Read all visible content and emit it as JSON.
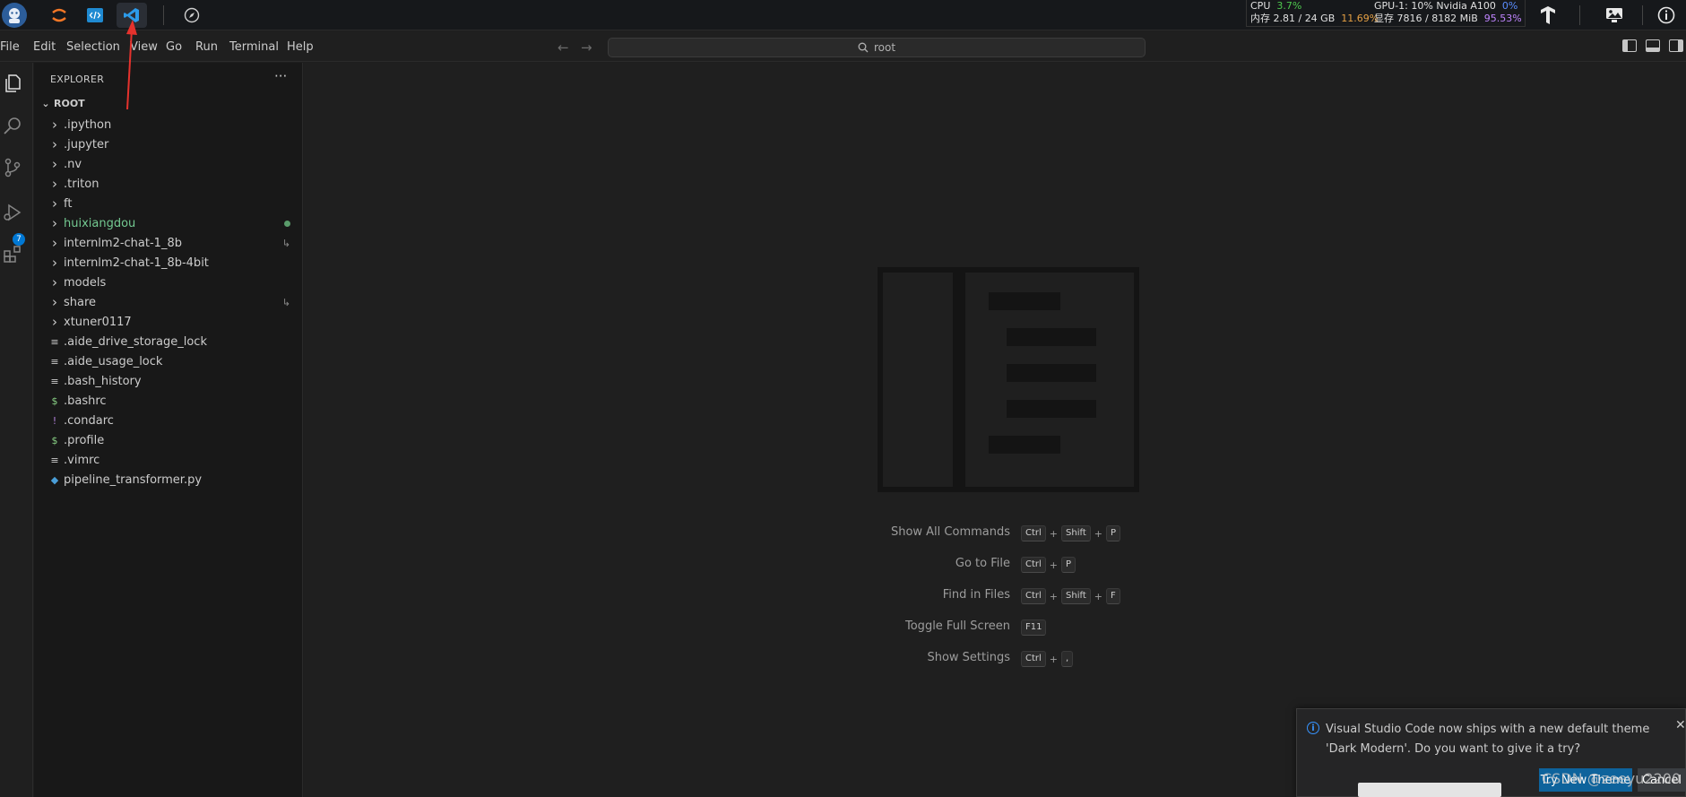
{
  "menubar": {
    "items": [
      "File",
      "Edit",
      "Selection",
      "View",
      "Go",
      "Run",
      "Terminal",
      "Help"
    ],
    "search_text": "root"
  },
  "system_stats": {
    "cpu_label": "CPU",
    "cpu_value": "3.7%",
    "mem_label": "内存 2.81 / 24 GB",
    "mem_value": "11.69%",
    "gpu_label": "GPU-1: 10% Nvidia A100",
    "gpu_value": "0%",
    "vram_label": "显存 7816 / 8182 MiB",
    "vram_value": "95.53%"
  },
  "activity_bar": {
    "source_control_badge": "7"
  },
  "explorer": {
    "title": "EXPLORER",
    "more": "···",
    "root_label": "ROOT",
    "items": [
      {
        "label": ".ipython",
        "kind": "folder",
        "icon": "›"
      },
      {
        "label": ".jupyter",
        "kind": "folder",
        "icon": "›"
      },
      {
        "label": ".nv",
        "kind": "folder",
        "icon": "›"
      },
      {
        "label": ".triton",
        "kind": "folder",
        "icon": "›"
      },
      {
        "label": "ft",
        "kind": "folder",
        "icon": "›"
      },
      {
        "label": "huixiangdou",
        "kind": "folder",
        "icon": "›",
        "color": "#73c991",
        "decoration": "dot"
      },
      {
        "label": "internlm2-chat-1_8b",
        "kind": "folder",
        "icon": "›",
        "decoration": "link"
      },
      {
        "label": "internlm2-chat-1_8b-4bit",
        "kind": "folder",
        "icon": "›"
      },
      {
        "label": "models",
        "kind": "folder",
        "icon": "›"
      },
      {
        "label": "share",
        "kind": "folder",
        "icon": "›",
        "decoration": "link"
      },
      {
        "label": "xtuner0117",
        "kind": "folder",
        "icon": "›"
      },
      {
        "label": ".aide_drive_storage_lock",
        "kind": "file",
        "icon": "≡"
      },
      {
        "label": ".aide_usage_lock",
        "kind": "file",
        "icon": "≡"
      },
      {
        "label": ".bash_history",
        "kind": "file",
        "icon": "≡"
      },
      {
        "label": ".bashrc",
        "kind": "file",
        "icon": "$",
        "icon_color": "#89d185"
      },
      {
        "label": ".condarc",
        "kind": "file",
        "icon": "!",
        "icon_color": "#b180d7"
      },
      {
        "label": ".profile",
        "kind": "file",
        "icon": "$",
        "icon_color": "#89d185"
      },
      {
        "label": ".vimrc",
        "kind": "file",
        "icon": "≡"
      },
      {
        "label": "pipeline_transformer.py",
        "kind": "file",
        "icon": "◆",
        "icon_color": "#4a9ed8"
      }
    ]
  },
  "editor": {
    "shortcuts": [
      {
        "label": "Show All Commands",
        "keys": [
          "Ctrl",
          "Shift",
          "P"
        ]
      },
      {
        "label": "Go to File",
        "keys": [
          "Ctrl",
          "P"
        ]
      },
      {
        "label": "Find in Files",
        "keys": [
          "Ctrl",
          "Shift",
          "F"
        ]
      },
      {
        "label": "Toggle Full Screen",
        "keys": [
          "F11"
        ]
      },
      {
        "label": "Show Settings",
        "keys": [
          "Ctrl",
          ","
        ]
      }
    ]
  },
  "notification": {
    "text": "Visual Studio Code now ships with a new default theme 'Dark Modern'. Do you want to give it a try?",
    "primary_button": "Try New Theme",
    "secondary_button": "Cancel",
    "close": "✕"
  },
  "watermark_credit": "CSDN @zeeyu2200",
  "colors": {
    "accent": "#0078d4",
    "sidebar_bg": "#181818",
    "editor_bg": "#1f1f1f",
    "arrow": "#e5322d"
  }
}
